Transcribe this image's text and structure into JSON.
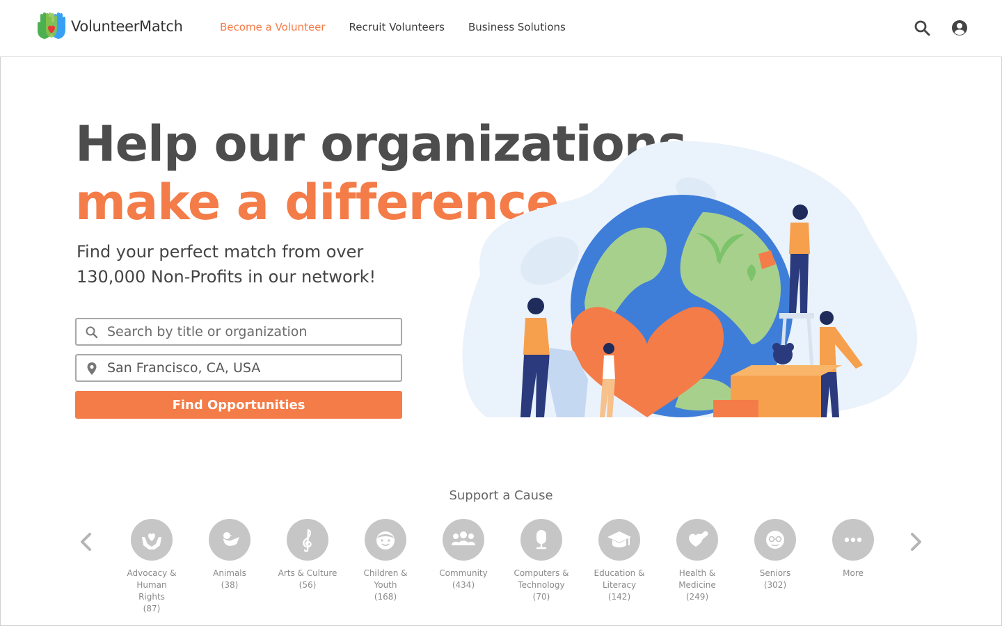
{
  "header": {
    "brand": "VolunteerMatch",
    "nav": [
      {
        "label": "Become a Volunteer",
        "active": true
      },
      {
        "label": "Recruit Volunteers",
        "active": false
      },
      {
        "label": "Business Solutions",
        "active": false
      }
    ],
    "icons": [
      "search-icon",
      "user-account-icon"
    ]
  },
  "hero": {
    "title_line1": "Help our organizations",
    "title_line2": "make a difference",
    "subtitle": "Find your perfect match from over 130,000 Non-Profits in our network!"
  },
  "search": {
    "keyword_placeholder": "Search by title or organization",
    "location_value": "San Francisco, CA, USA",
    "submit_label": "Find Opportunities"
  },
  "causes": {
    "title": "Support a Cause",
    "items": [
      {
        "label": "Advocacy &\nHuman\nRights\n(87)",
        "icon": "hands-heart-icon"
      },
      {
        "label": "Animals\n(38)",
        "icon": "bird-icon"
      },
      {
        "label": "Arts & Culture\n(56)",
        "icon": "treble-clef-icon"
      },
      {
        "label": "Children &\nYouth\n(168)",
        "icon": "child-face-icon"
      },
      {
        "label": "Community\n(434)",
        "icon": "people-group-icon"
      },
      {
        "label": "Computers &\nTechnology\n(70)",
        "icon": "microphone-icon"
      },
      {
        "label": "Education &\nLiteracy\n(142)",
        "icon": "graduation-cap-icon"
      },
      {
        "label": "Health &\nMedicine\n(249)",
        "icon": "heart-pill-icon"
      },
      {
        "label": "Seniors\n(302)",
        "icon": "senior-face-icon"
      },
      {
        "label": "More",
        "icon": "more-dots-icon"
      }
    ]
  },
  "colors": {
    "accent": "#f47c48",
    "heading": "#4d4d4d",
    "icon_gray": "#c6c6c6"
  }
}
